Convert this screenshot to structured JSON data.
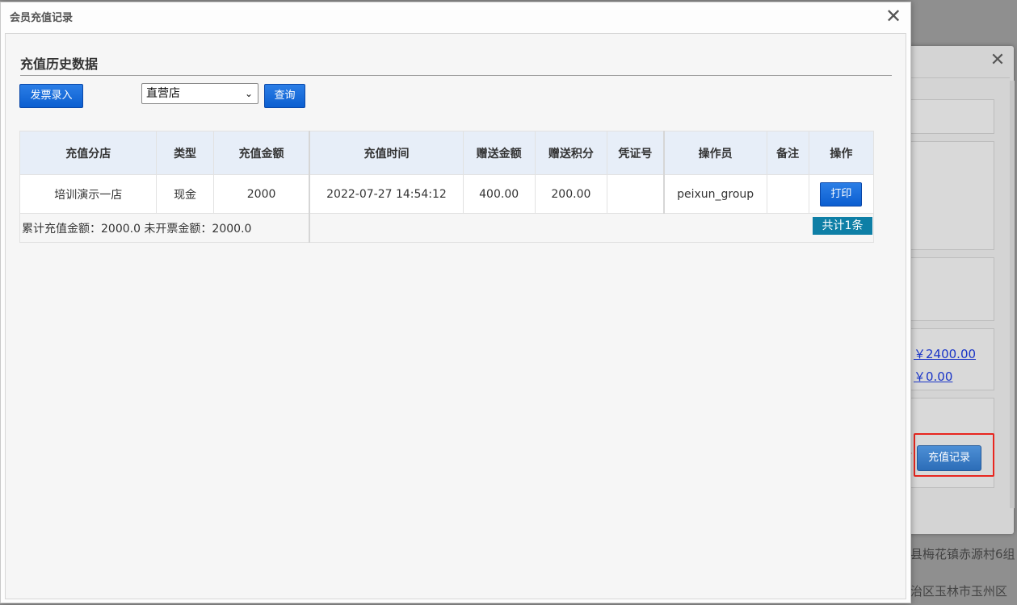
{
  "modal": {
    "title": "会员充值记录",
    "section_title": "充值历史数据",
    "invoice_button": "发票录入",
    "store_select": {
      "selected": "直营店"
    },
    "query_button": "查询",
    "table": {
      "headers": [
        "充值分店",
        "类型",
        "充值金额",
        "充值时间",
        "赠送金额",
        "赠送积分",
        "凭证号",
        "操作员",
        "备注",
        "操作"
      ],
      "rows": [
        {
          "store": "培训演示一店",
          "type": "现金",
          "amount": "2000",
          "time": "2022-07-27 14:54:12",
          "bonus_amount": "400.00",
          "bonus_points": "200.00",
          "voucher": "",
          "operator": "peixun_group",
          "remark": "",
          "action": "打印"
        }
      ],
      "summary": "累计充值金额：2000.0 未开票金额：2000.0",
      "total": "共计1条"
    }
  },
  "background": {
    "amount_1": "￥2400.00",
    "amount_2": "￥0.00",
    "recharge_record_button": "充值记录",
    "address_1": "县梅花镇赤源村6组",
    "address_2": "治区玉林市玉州区"
  },
  "colors": {
    "primary_button": "#0b5ed0",
    "table_header": "#e7eef8",
    "badge": "#0e7fa6",
    "highlight": "#e8261f"
  },
  "icons": {
    "close": "close-icon",
    "dropdown": "chevron-down-icon"
  }
}
